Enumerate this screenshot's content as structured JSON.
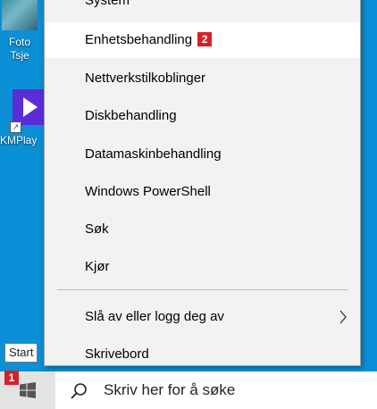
{
  "desktop": {
    "icons": [
      {
        "label": "Foto\nTsje",
        "icon": "photo-thumbnail"
      },
      {
        "label": "KMPlay",
        "icon": "kmplayer-app-icon"
      }
    ]
  },
  "context_menu": {
    "items": [
      {
        "label": "System"
      },
      {
        "label": "Enhetsbehandling",
        "badge": "2",
        "highlighted": true
      },
      {
        "label": "Nettverkstilkoblinger"
      },
      {
        "label": "Diskbehandling"
      },
      {
        "label": "Datamaskinbehandling"
      },
      {
        "label": "Windows PowerShell"
      },
      {
        "label": "Søk"
      },
      {
        "label": "Kjør"
      },
      {
        "label": "Slå av eller logg deg av",
        "submenu_icon": "chevron-right-icon"
      },
      {
        "label": "Skrivebord"
      }
    ]
  },
  "taskbar": {
    "start_tooltip": "Start",
    "start_badge": "1",
    "search_placeholder": "Skriv her for å søke"
  },
  "colors": {
    "desktop_background": "#0b8fd6",
    "badge_red": "#d2232a",
    "menu_background": "#f2f2f2"
  }
}
